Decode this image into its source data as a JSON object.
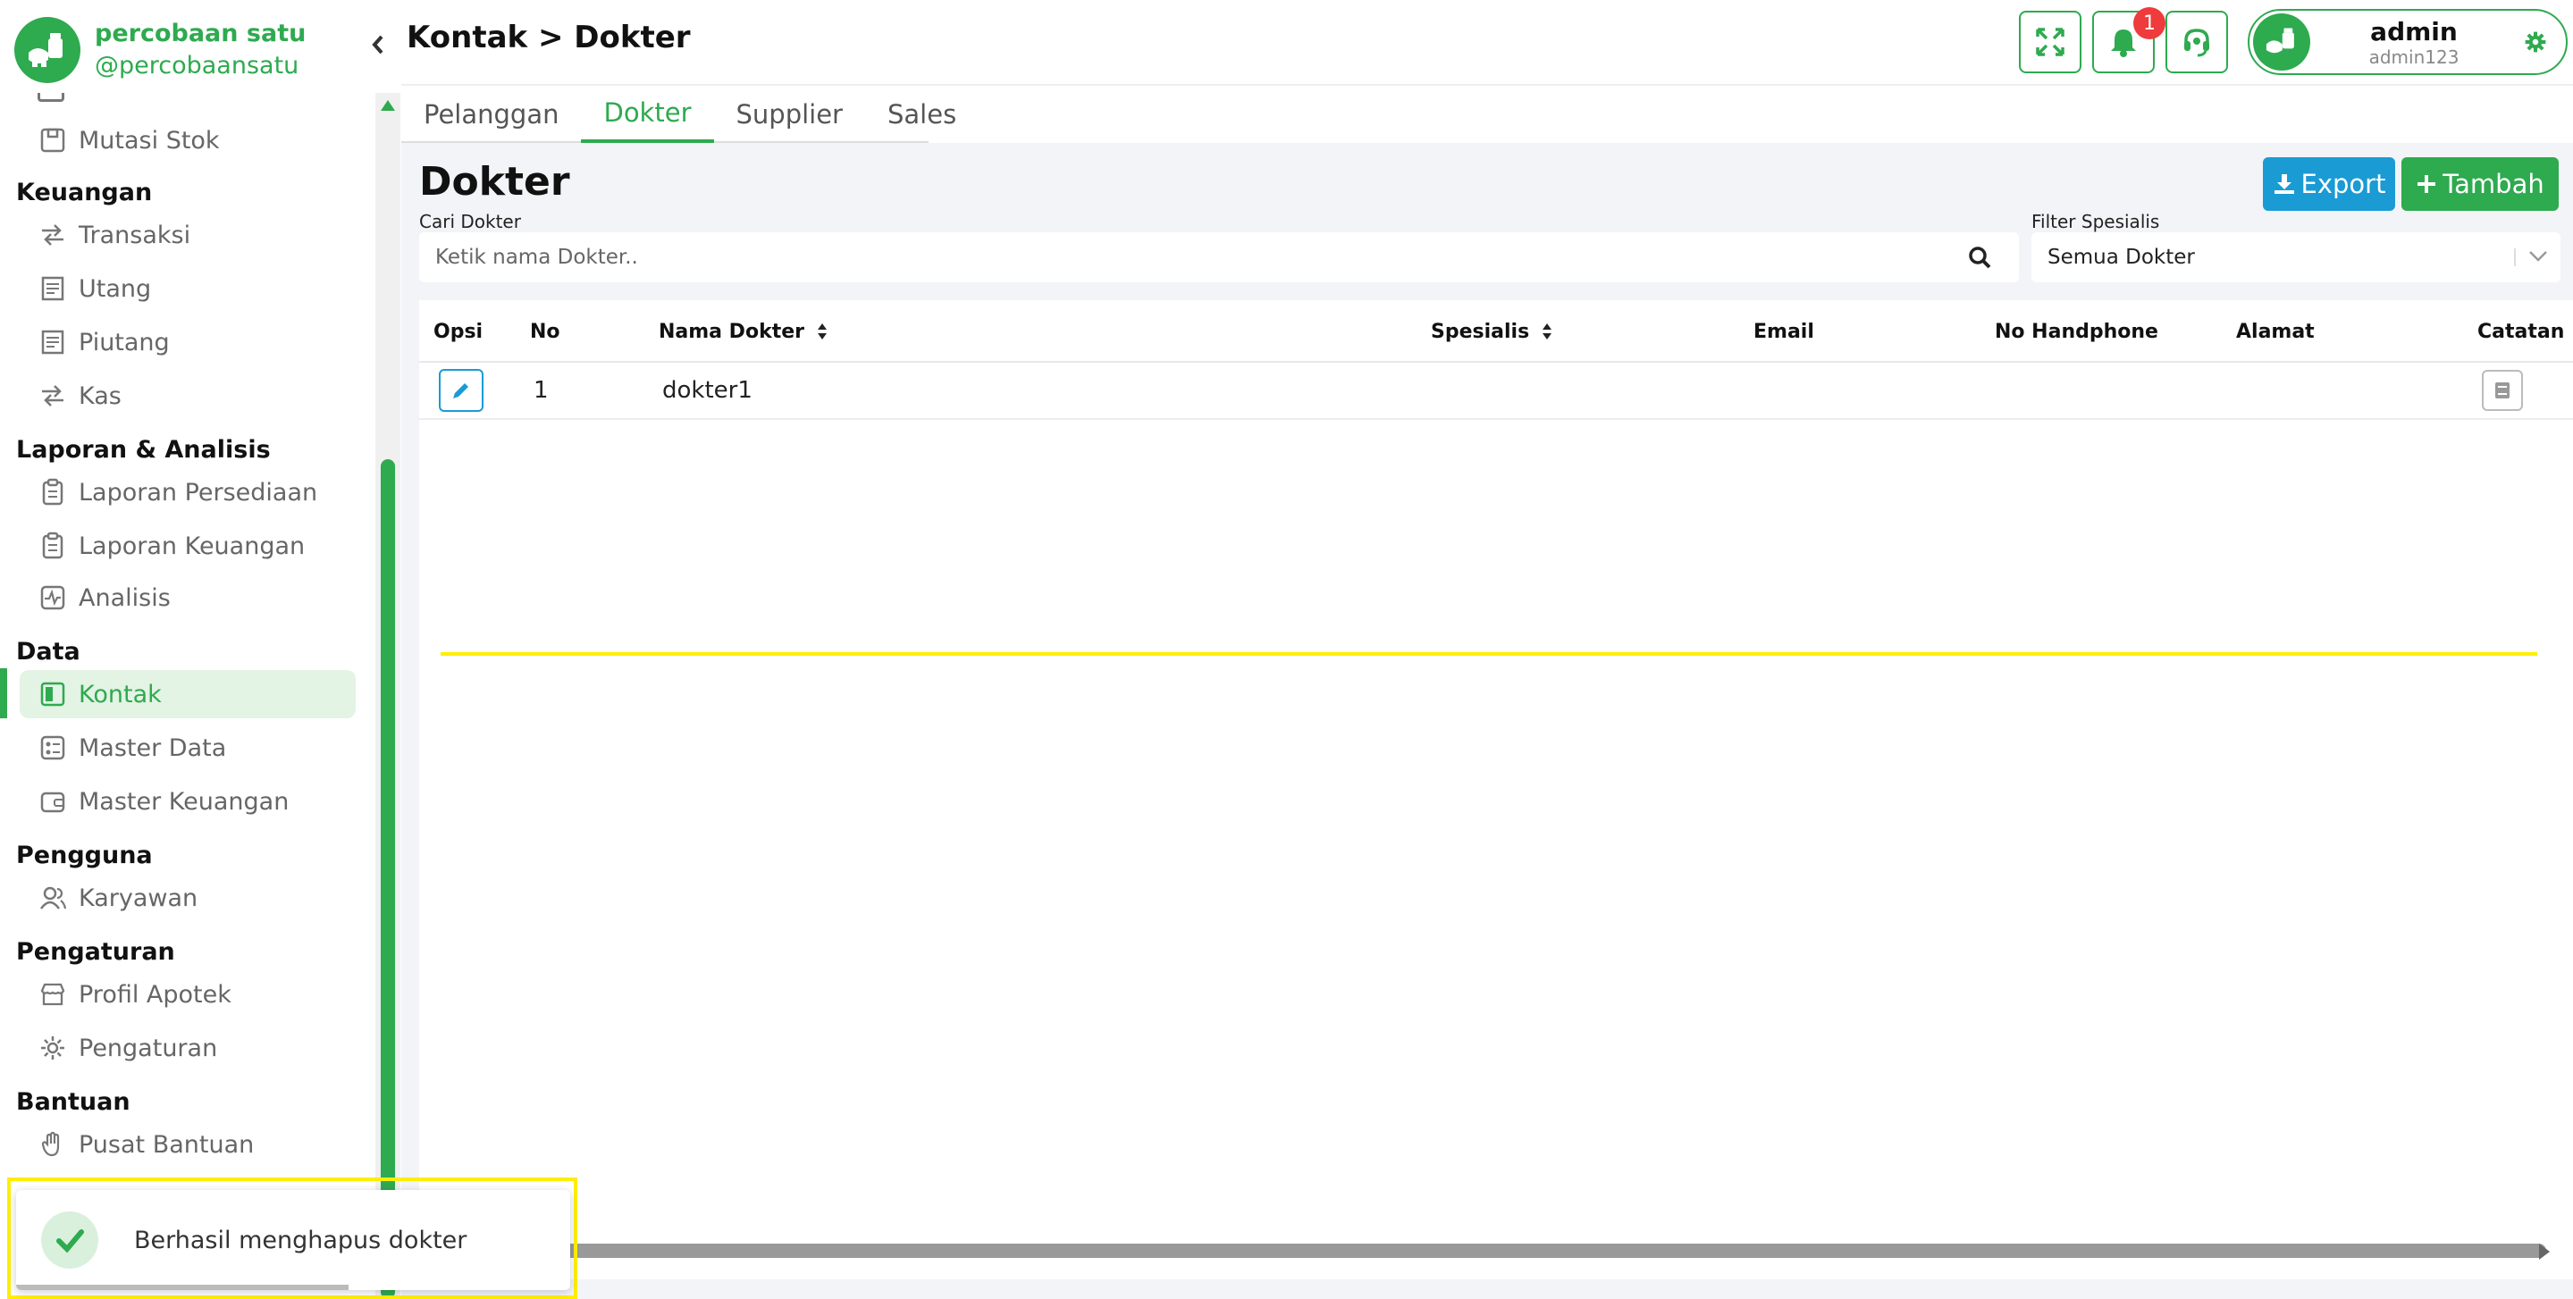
{
  "brand": {
    "name": "percobaan satu",
    "handle": "@percobaansatu"
  },
  "sidebar": {
    "sections": [
      {
        "title": "Keuangan",
        "items": [
          "Transaksi",
          "Utang",
          "Piutang",
          "Kas"
        ]
      },
      {
        "title": "Laporan & Analisis",
        "items": [
          "Laporan Persediaan",
          "Laporan Keuangan",
          "Analisis"
        ]
      },
      {
        "title": "Data",
        "items": [
          "Kontak",
          "Master Data",
          "Master Keuangan"
        ]
      },
      {
        "title": "Pengguna",
        "items": [
          "Karyawan"
        ]
      },
      {
        "title": "Pengaturan",
        "items": [
          "Profil Apotek",
          "Pengaturan"
        ]
      },
      {
        "title": "Bantuan",
        "items": [
          "Pusat Bantuan"
        ]
      }
    ],
    "top_item": "Mutasi Stok",
    "active_item": "Kontak"
  },
  "header": {
    "breadcrumb": "Kontak > Dokter",
    "notification_count": "1",
    "user": {
      "name": "admin",
      "username": "admin123"
    }
  },
  "tabs": [
    "Pelanggan",
    "Dokter",
    "Supplier",
    "Sales"
  ],
  "active_tab": "Dokter",
  "page": {
    "title": "Dokter",
    "export_label": "Export",
    "add_label": "Tambah",
    "search_label": "Cari Dokter",
    "search_placeholder": "Ketik nama Dokter..",
    "filter_label": "Filter Spesialis",
    "filter_value": "Semua Dokter"
  },
  "table": {
    "columns": [
      "Opsi",
      "No",
      "Nama Dokter",
      "Spesialis",
      "Email",
      "No Handphone",
      "Alamat",
      "Catatan"
    ],
    "rows": [
      {
        "no": "1",
        "nama": "dokter1",
        "spesialis": "",
        "email": "",
        "hp": "",
        "alamat": ""
      }
    ]
  },
  "toast": {
    "message": "Berhasil menghapus dokter",
    "progress": 0.6
  },
  "colors": {
    "primary": "#2eaa4f",
    "info": "#1a9bd4",
    "danger": "#ee3b3b",
    "highlight": "#ffee00"
  }
}
